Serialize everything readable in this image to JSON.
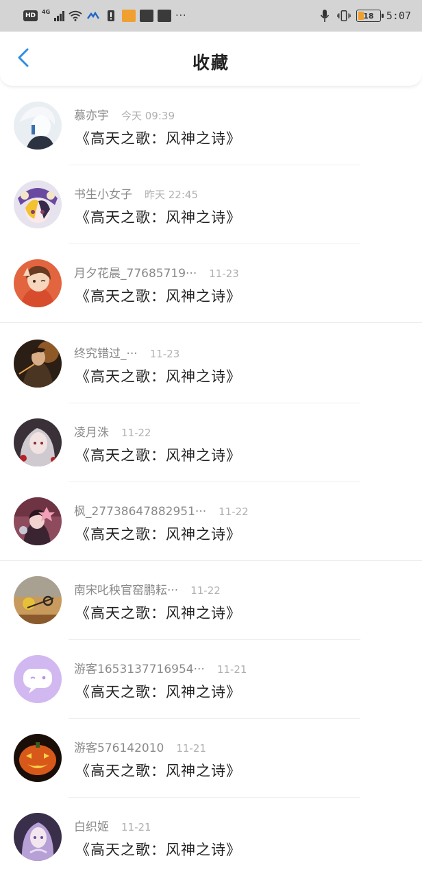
{
  "status_bar": {
    "hd_label": "HD",
    "network_label": "4G",
    "dots": "···",
    "battery_level": "18",
    "time": "5:07"
  },
  "header": {
    "title": "收藏"
  },
  "items": [
    {
      "name": "慕亦宇",
      "time": "今天 09:39",
      "title": "《高天之歌：风神之诗》"
    },
    {
      "name": "书生小女子",
      "time": "昨天 22:45",
      "title": "《高天之歌：风神之诗》"
    },
    {
      "name": "月夕花晨_77685719···",
      "time": "11-23",
      "title": "《高天之歌：风神之诗》"
    },
    {
      "name": "终究错过_···",
      "time": "11-23",
      "title": "《高天之歌：风神之诗》"
    },
    {
      "name": "凌月洙",
      "time": "11-22",
      "title": "《高天之歌：风神之诗》"
    },
    {
      "name": "枫_27738647882951···",
      "time": "11-22",
      "title": "《高天之歌：风神之诗》"
    },
    {
      "name": "南宋叱秧官窑鹏耘···",
      "time": "11-22",
      "title": "《高天之歌：风神之诗》"
    },
    {
      "name": "游客1653137716954···",
      "time": "11-21",
      "title": "《高天之歌：风神之诗》"
    },
    {
      "name": "游客576142010",
      "time": "11-21",
      "title": "《高天之歌：风神之诗》"
    },
    {
      "name": "白织姬",
      "time": "11-21",
      "title": "《高天之歌：风神之诗》"
    }
  ]
}
